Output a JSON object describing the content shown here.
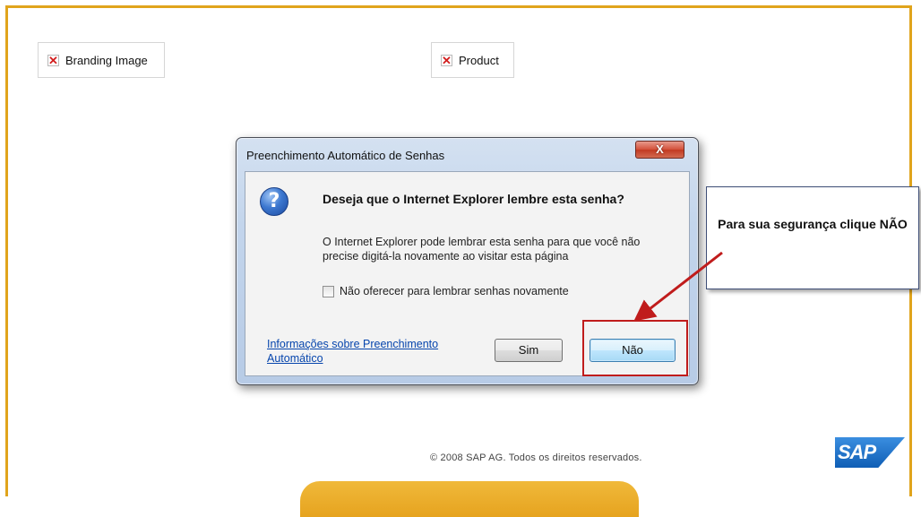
{
  "page": {
    "branding_image_alt": "Branding Image",
    "product_image_alt": "Product",
    "copyright": "© 2008 SAP AG. Todos os direitos reservados.",
    "logo_text": "SAP",
    "frame_color": "#e0a41c"
  },
  "dialog": {
    "title": "Preenchimento Automático de Senhas",
    "close_glyph": "X",
    "question_glyph": "?",
    "main_instruction": "Deseja que o Internet Explorer lembre esta senha?",
    "explanation": "O Internet Explorer pode lembrar esta senha para que você não precise digitá-la novamente ao visitar esta página",
    "dont_offer_label": "Não oferecer para lembrar senhas novamente",
    "dont_offer_checked": false,
    "info_link": "Informações sobre Preenchimento Automático",
    "yes_label": "Sim",
    "no_label": "Não"
  },
  "annotation": {
    "callout_text": "Para sua segurança clique NÃO",
    "highlight_color": "#c01c1c"
  }
}
